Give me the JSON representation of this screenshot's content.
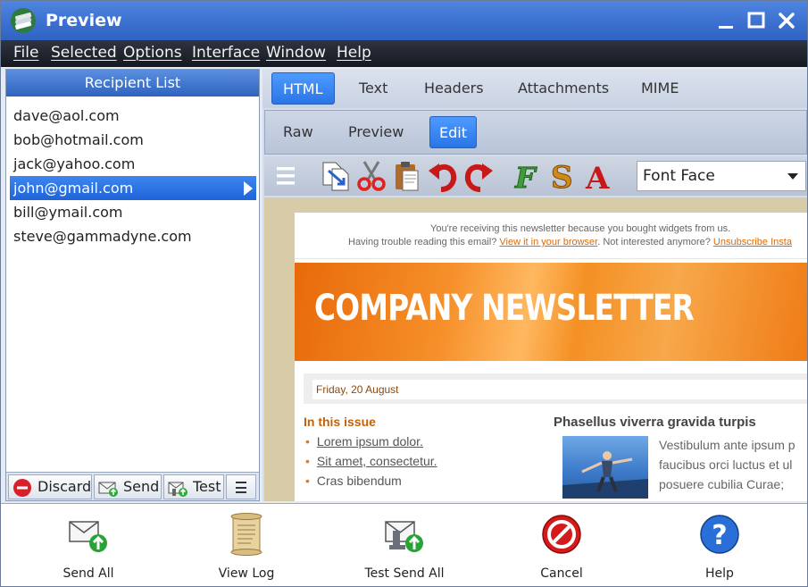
{
  "window": {
    "title": "Preview"
  },
  "menu": [
    "File",
    "Selected",
    "Options",
    "Interface",
    "Window",
    "Help"
  ],
  "recipients": {
    "header": "Recipient List",
    "items": [
      "dave@aol.com",
      "bob@hotmail.com",
      "jack@yahoo.com",
      "john@gmail.com",
      "bill@ymail.com",
      "steve@gammadyne.com"
    ],
    "selected": "john@gmail.com",
    "actions": {
      "discard": "Discard",
      "send": "Send",
      "test": "Test"
    }
  },
  "tabs": [
    "HTML",
    "Text",
    "Headers",
    "Attachments",
    "MIME"
  ],
  "active_tab": "HTML",
  "subtabs": [
    "Raw",
    "Preview",
    "Edit"
  ],
  "active_subtab": "Edit",
  "toolbar": {
    "font_face": "Font Face"
  },
  "newsletter": {
    "notice_line1": "You're receiving this newsletter because you bought widgets from us.",
    "notice_line2_pre": "Having trouble reading this email?",
    "notice_link1": "View it in your browser",
    "notice_line2_mid": ". Not interested anymore?",
    "notice_link2": "Unsubscribe Insta",
    "banner_title": "COMPANY NEWSLETTER",
    "date": "Friday, 20 August",
    "issue_heading": "In this issue",
    "issue_items": [
      "Lorem ipsum dolor.",
      "Sit amet, consectetur.",
      "Cras bibendum"
    ],
    "article_heading": "Phasellus viverra gravida turpis",
    "article_lines": [
      "Vestibulum ante ipsum p",
      "faucibus orci luctus et ul",
      "posuere cubilia Curae;"
    ]
  },
  "bottom": {
    "send_all": "Send All",
    "view_log": "View Log",
    "test_send_all": "Test Send All",
    "cancel": "Cancel",
    "help": "Help"
  },
  "colors": {
    "title_blue": "#3a6fcf",
    "selection_blue": "#2a75e6",
    "banner_orange": "#f49024",
    "link_orange": "#e06a00"
  }
}
